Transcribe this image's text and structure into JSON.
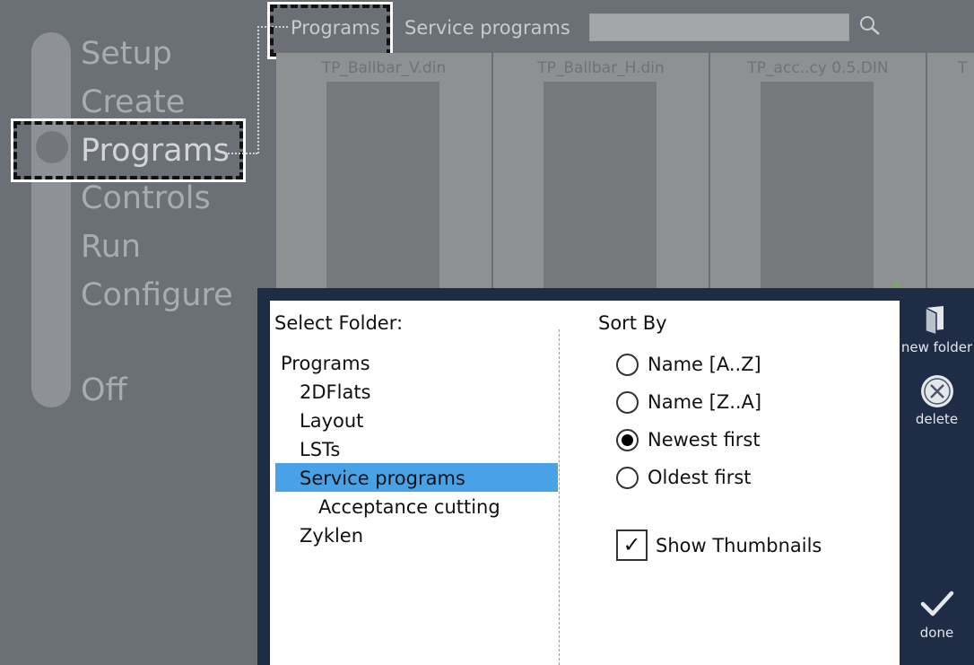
{
  "nav": {
    "items": [
      "Setup",
      "Create",
      "Programs",
      "Controls",
      "Run",
      "Configure",
      "Off"
    ],
    "active": "Programs"
  },
  "tabs": {
    "programs": "Programs",
    "service_programs": "Service programs"
  },
  "search": {
    "placeholder": "",
    "icon": "search-icon"
  },
  "thumbnails": [
    "TP_Ballbar_V.din",
    "TP_Ballbar_H.din",
    "TP_acc..cy 0.5.DIN",
    "T"
  ],
  "dialog": {
    "select_folder_label": "Select Folder:",
    "folders": {
      "root": "Programs",
      "f1": "2DFlats",
      "f2": "Layout",
      "f3": "LSTs",
      "f4": "Service programs",
      "f5": "Acceptance cutting",
      "f6": "Zyklen"
    },
    "selected_folder": "Service programs",
    "sort_by_label": "Sort By",
    "sort_options": [
      "Name [A..Z]",
      "Name [Z..A]",
      "Newest first",
      "Oldest first"
    ],
    "sort_selected": "Newest first",
    "show_thumbnails_label": "Show Thumbnails",
    "show_thumbnails_checked": true,
    "check_mark": "✓",
    "buttons": {
      "new_folder": "new folder",
      "delete": "delete",
      "done": "done"
    }
  },
  "colors": {
    "background": "#6b7076",
    "dialog_frame": "#1e2d45",
    "selection": "#4aa2e6"
  }
}
